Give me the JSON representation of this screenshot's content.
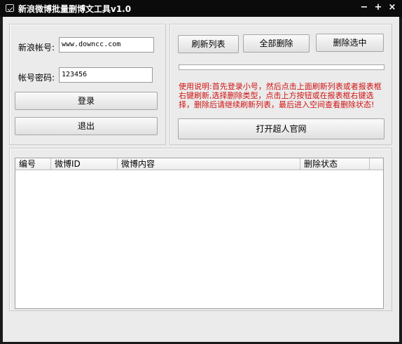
{
  "window": {
    "title": "新浪微博批量删博文工具v1.0",
    "min_glyph": "−",
    "max_glyph": "+",
    "close_glyph": "×"
  },
  "login": {
    "account_label": "新浪帐号:",
    "account_value": "www.downcc.com",
    "password_label": "帐号密码:",
    "password_value": "123456",
    "login_button": "登录",
    "logout_button": "退出"
  },
  "actions": {
    "refresh_button": "刷新列表",
    "delete_all_button": "全部删除",
    "delete_selected_button": "删除选中",
    "progress_percent": 0,
    "instructions": "使用说明:首先登录小号，然后点击上面刷新列表或者报表框右键刷新,选择删除类型，点击上方按钮或在报表框右键选择，删除后请继续刷新列表，最后进入空间查看删除状态!",
    "open_site_button": "打开超人官网"
  },
  "list": {
    "columns": [
      "编号",
      "微博ID",
      "微博内容",
      "删除状态"
    ],
    "rows": []
  },
  "colors": {
    "titlebar": "#0b0b0b",
    "window_bg": "#ebebeb",
    "instruction_text": "#d01010"
  }
}
